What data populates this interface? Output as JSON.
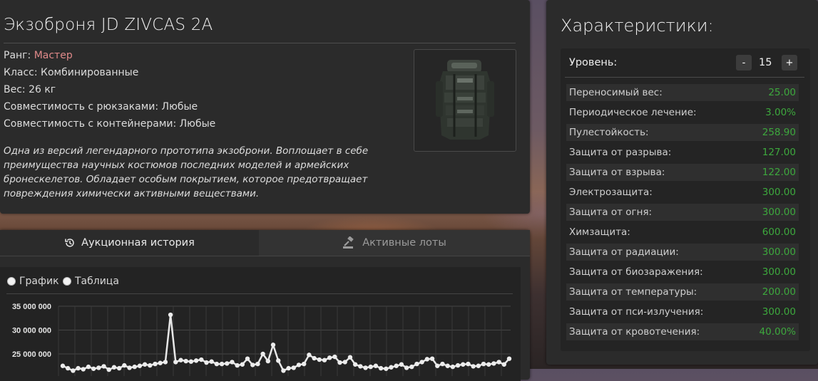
{
  "item": {
    "title": "Экзоброня JD ZIVCAS 2A",
    "rank_label": "Ранг: ",
    "rank_value": "Мастер",
    "class_line": "Класс: Комбинированные",
    "weight_line": "Вес: 26 кг",
    "backpack_line": "Совместимость с рюкзаками: Любые",
    "container_line": "Совместимость с контейнерами: Любые",
    "description": "Одна из версий легендарного прототипа экзоброни. Воплощает в себе преимущества научных костюмов последних моделей и армейских бронескелетов. Обладает особым покрытием, которое предотвращает повреждения химически активными веществами."
  },
  "tabs": {
    "history": "Аукционная история",
    "lots": "Активные лоты"
  },
  "view_options": {
    "chart": "График",
    "table": "Таблица"
  },
  "chart_data": {
    "type": "line",
    "y_tick_labels": [
      "35 000 000",
      "30 000 000",
      "25 000 000"
    ],
    "ylim_visible": [
      23500000,
      35000000
    ],
    "x": [
      1,
      2,
      3,
      4,
      5,
      6,
      7,
      8,
      9,
      10,
      11,
      12,
      13,
      14,
      15,
      16,
      17,
      18,
      19,
      20,
      21,
      22,
      23,
      24,
      25,
      26,
      27,
      28,
      29,
      30,
      31,
      32,
      33,
      34,
      35,
      36,
      37,
      38,
      39,
      40,
      41,
      42,
      43,
      44,
      45,
      46,
      47,
      48,
      49,
      50,
      51,
      52,
      53,
      54,
      55,
      56,
      57,
      58,
      59,
      60,
      61,
      62,
      63,
      64,
      65,
      66,
      67,
      68,
      69,
      70,
      71,
      72,
      73,
      74,
      75,
      76,
      77,
      78,
      79,
      80,
      81,
      82,
      83,
      84,
      85,
      86,
      87,
      88
    ],
    "values": [
      22500000,
      22000000,
      21500000,
      22000000,
      21800000,
      22300000,
      21900000,
      22100000,
      22400000,
      21700000,
      22200000,
      22000000,
      22600000,
      22100000,
      22300000,
      22500000,
      22800000,
      22600000,
      22900000,
      23100000,
      23300000,
      33200000,
      23300000,
      23700000,
      23500000,
      23400000,
      23600000,
      23800000,
      23200000,
      23400000,
      22900000,
      22900000,
      23000000,
      23300000,
      22600000,
      22800000,
      24000000,
      22700000,
      22900000,
      25000000,
      23500000,
      26900000,
      23600000,
      21500000,
      22000000,
      22100000,
      22700000,
      22900000,
      24800000,
      24100000,
      23800000,
      23700000,
      24200000,
      24400000,
      23200000,
      23300000,
      24300000,
      22800000,
      22400000,
      22100000,
      22300000,
      22500000,
      22000000,
      21900000,
      22200000,
      22500000,
      22800000,
      22100000,
      22300000,
      22900000,
      23300000,
      23900000,
      24000000,
      22500000,
      22900000,
      22500000,
      22300000,
      22600000,
      22800000,
      22900000,
      22400000,
      22500000,
      22900000,
      22800000,
      23000000,
      23300000,
      22800000,
      24000000
    ]
  },
  "stats": {
    "title": "Характеристики:",
    "level_label": "Уровень:",
    "level_value": "15",
    "minus": "-",
    "plus": "+",
    "rows": [
      {
        "name": "Переносимый вес:",
        "value": "25.00"
      },
      {
        "name": "Периодическое лечение:",
        "value": "3.00%"
      },
      {
        "name": "Пулестойкость:",
        "value": "258.90"
      },
      {
        "name": "Защита от разрыва:",
        "value": "127.00"
      },
      {
        "name": "Защита от взрыва:",
        "value": "122.00"
      },
      {
        "name": "Электрозащита:",
        "value": "300.00"
      },
      {
        "name": "Защита от огня:",
        "value": "300.00"
      },
      {
        "name": "Химзащита:",
        "value": "600.00"
      },
      {
        "name": "Защита от радиации:",
        "value": "300.00"
      },
      {
        "name": "Защита от биозаражения:",
        "value": "300.00"
      },
      {
        "name": "Защита от температуры:",
        "value": "200.00"
      },
      {
        "name": "Защита от пси-излучения:",
        "value": "300.00"
      },
      {
        "name": "Защита от кровотечения:",
        "value": "40.00%"
      }
    ]
  },
  "colors": {
    "rank": "#e08a8a",
    "stat_value": "#3da83d",
    "panel": "#2b2b2b"
  }
}
